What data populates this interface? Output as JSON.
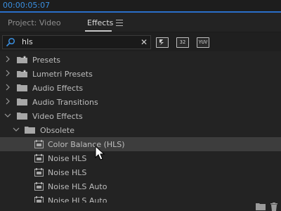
{
  "timecode": "00:00:05:07",
  "tabs": {
    "project": "Project: Video",
    "effects": "Effects"
  },
  "search": {
    "value": "hls"
  },
  "filter_buttons": {
    "accel": "",
    "b32": "32",
    "yuv": "YUV"
  },
  "tree": {
    "presets": "Presets",
    "lumetri_presets": "Lumetri Presets",
    "audio_effects": "Audio Effects",
    "audio_transitions": "Audio Transitions",
    "video_effects": "Video Effects",
    "obsolete": "Obsolete",
    "effects": [
      "Color Balance (HLS)",
      "Noise HLS",
      "Noise HLS",
      "Noise HLS Auto",
      "Noise HLS Auto"
    ]
  },
  "colors": {
    "accent": "#2a6fc9",
    "timecode": "#3a8fe0",
    "selected_row": "#3d3d3d"
  },
  "icons": {
    "search": "search-icon",
    "clear": "close-icon",
    "menu": "hamburger-menu-icon",
    "folder": "folder-icon",
    "preset_folder": "preset-folder-icon",
    "effect": "effect-icon",
    "new_bin": "new-bin-icon",
    "trash": "trash-icon"
  }
}
